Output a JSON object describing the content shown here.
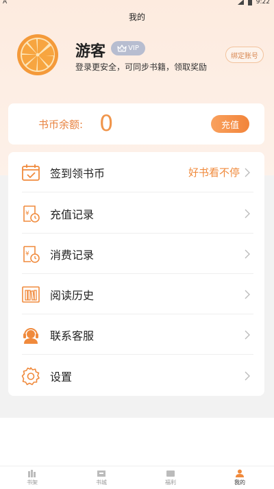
{
  "status_bar": {
    "left": "A",
    "time": "9:22"
  },
  "header": {
    "title": "我的"
  },
  "profile": {
    "username": "游客",
    "vip_label": "VIP",
    "login_hint": "登录更安全，可同步书籍，领取奖励",
    "bind_label": "绑定账号"
  },
  "balance": {
    "label": "书币余额:",
    "value": "0",
    "recharge_label": "充值"
  },
  "menu": {
    "items": [
      {
        "label": "签到领书币",
        "right_text": "好书看不停",
        "icon": "calendar-check-icon"
      },
      {
        "label": "充值记录",
        "icon": "receipt-clock-icon"
      },
      {
        "label": "消费记录",
        "icon": "receipt-clock-icon"
      },
      {
        "label": "阅读历史",
        "icon": "bookshelf-icon"
      },
      {
        "label": "联系客服",
        "icon": "headset-icon"
      },
      {
        "label": "设置",
        "icon": "gear-icon"
      }
    ]
  },
  "tabs": [
    {
      "label": "书架",
      "icon": "bookshelf-tab-icon",
      "active": false
    },
    {
      "label": "书城",
      "icon": "store-tab-icon",
      "active": false
    },
    {
      "label": "福利",
      "icon": "gift-tab-icon",
      "active": false
    },
    {
      "label": "我的",
      "icon": "user-tab-icon",
      "active": true
    }
  ],
  "colors": {
    "accent": "#f08a3c",
    "header_bg": "#fdebdf",
    "vip_badge": "#b7bdd0"
  }
}
